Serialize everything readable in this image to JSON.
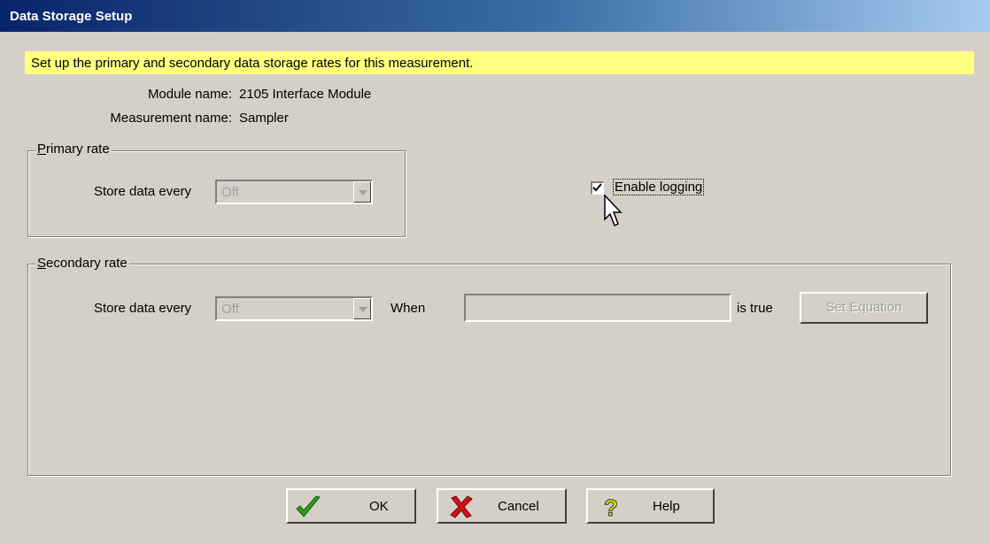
{
  "window": {
    "title": "Data Storage Setup"
  },
  "banner": {
    "text": "Set up the primary and secondary data storage rates for this measurement."
  },
  "info": {
    "module_label": "Module name:",
    "module_value": "2105 Interface Module",
    "measurement_label": "Measurement name:",
    "measurement_value": "Sampler"
  },
  "primary": {
    "title_accel": "P",
    "title_rest": "rimary rate",
    "store_label": "Store data every",
    "store_value": "Off"
  },
  "logging": {
    "label": "Enable logging",
    "checked": true
  },
  "secondary": {
    "title_accel": "S",
    "title_rest": "econdary rate",
    "store_label": "Store data every",
    "store_value": "Off",
    "when_label": "When",
    "equation_value": "",
    "is_true_label": "is true",
    "set_equation_label": "Set Equation"
  },
  "buttons": {
    "ok": "OK",
    "cancel": "Cancel",
    "help": "Help"
  },
  "colors": {
    "title_start": "#0a246a",
    "title_end": "#a6caf0",
    "banner": "#ffff80",
    "face": "#d4d0c8",
    "ok_icon": "#2e9c1a",
    "cancel_icon": "#d81010",
    "help_icon": "#f0e000"
  }
}
